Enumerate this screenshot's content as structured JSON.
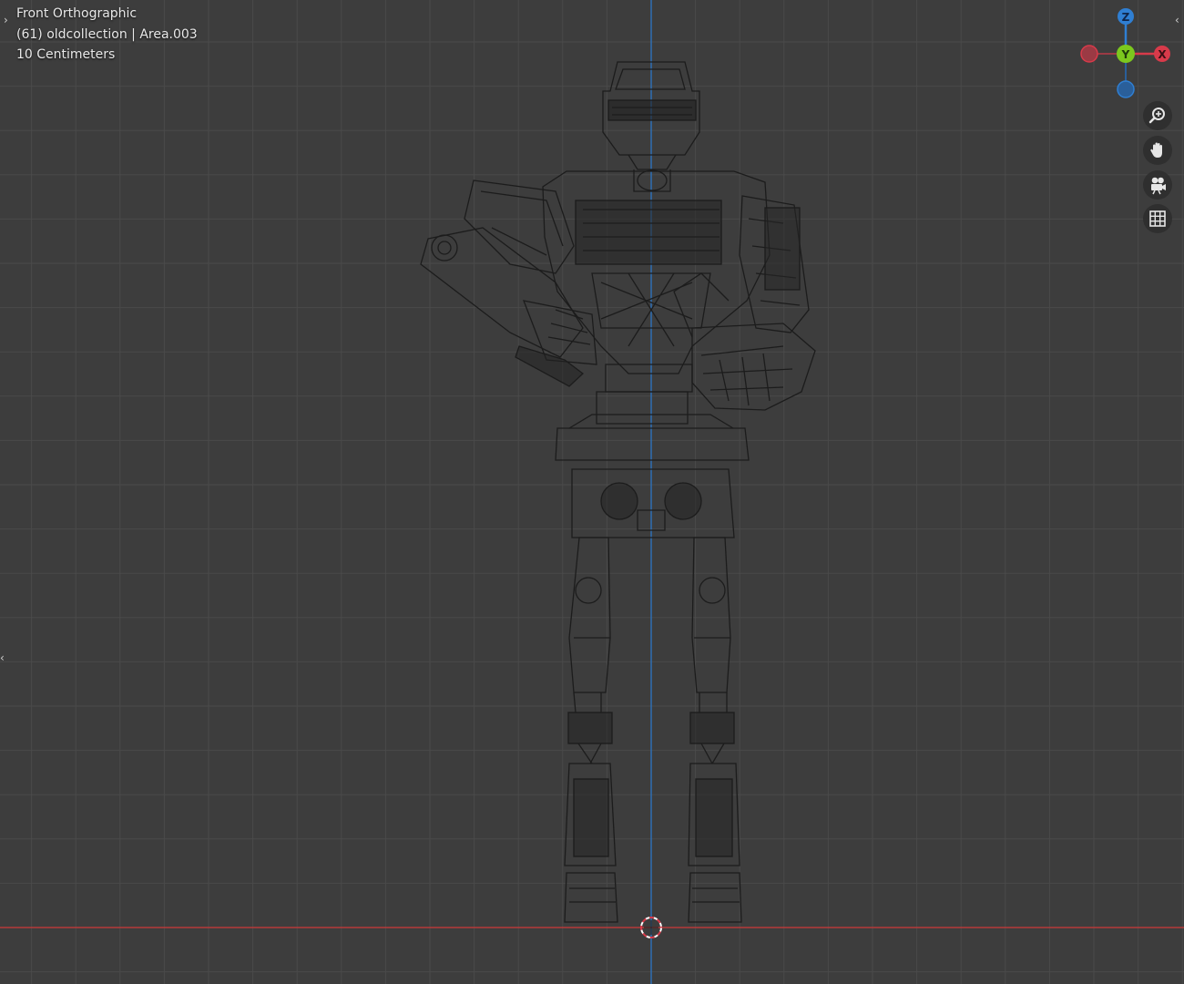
{
  "viewport": {
    "view_name": "Front Orthographic",
    "collection_info": "(61) oldcollection | Area.003",
    "grid_scale": "10 Centimeters"
  },
  "gizmo": {
    "z_label": "Z",
    "y_label": "Y",
    "x_label": "X",
    "colors": {
      "x": "#d83a4a",
      "y": "#7cc81e",
      "z": "#2f7fd3",
      "neg_x": "#9b3a44",
      "neg_z": "#2a5f9a"
    }
  },
  "nav_buttons": [
    {
      "name": "zoom-icon"
    },
    {
      "name": "hand-pan-icon"
    },
    {
      "name": "camera-icon"
    },
    {
      "name": "grid-perspective-icon"
    }
  ],
  "colors": {
    "background": "#3d3d3d",
    "grid_line": "#4a4a4a",
    "x_axis": "#b53a3a",
    "z_axis": "#2f6fb3",
    "wireframe": "#1a1a1a"
  }
}
